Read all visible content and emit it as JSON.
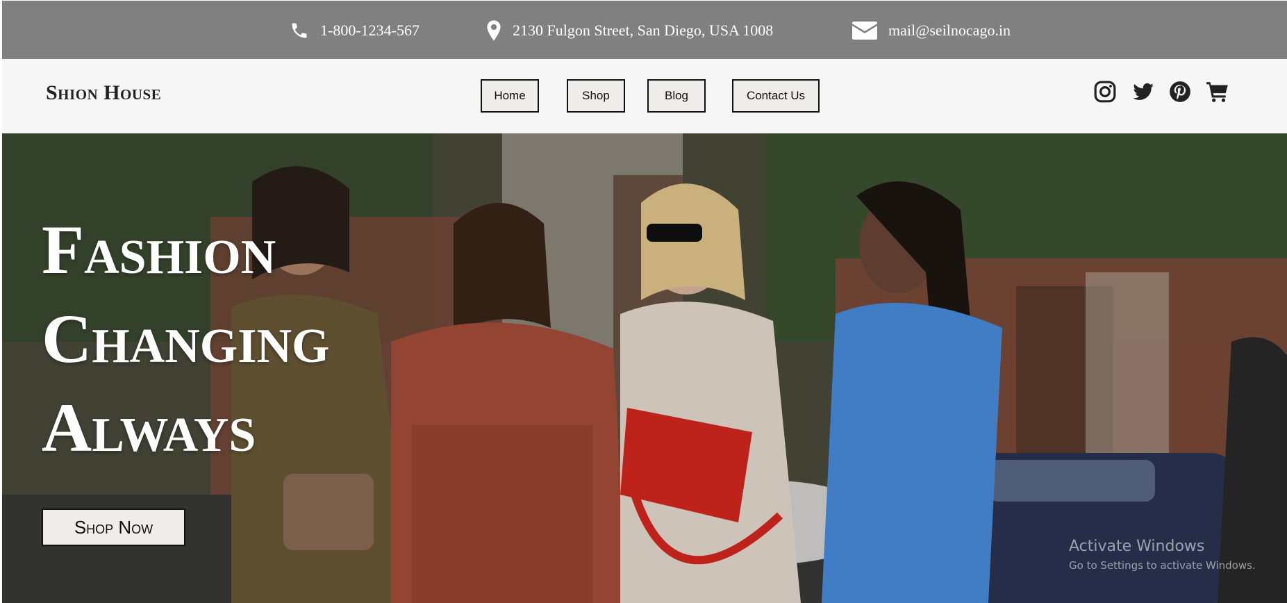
{
  "topbar": {
    "phone": {
      "icon": "phone-icon",
      "text": "1-800-1234-567"
    },
    "address": {
      "icon": "map-pin-icon",
      "text": "2130 Fulgon Street, San Diego, USA 1008"
    },
    "email": {
      "icon": "envelope-icon",
      "text": "mail@seilnocago.in"
    }
  },
  "navbar": {
    "brand": "Shion House",
    "links": [
      {
        "label": "Home"
      },
      {
        "label": "Shop"
      },
      {
        "label": "Blog"
      },
      {
        "label": "Contact Us"
      }
    ],
    "icons": [
      "instagram-icon",
      "twitter-icon",
      "pinterest-icon",
      "cart-icon"
    ]
  },
  "hero": {
    "title_lines": [
      "Fashion",
      "Changing",
      "Always"
    ],
    "cta_label": "Shop Now"
  },
  "watermark": {
    "line1": "Activate Windows",
    "line2": "Go to Settings to activate Windows."
  },
  "colors": {
    "topbar_bg": "#808080",
    "navbar_bg": "#f7f6f7",
    "button_bg": "#efedea"
  }
}
